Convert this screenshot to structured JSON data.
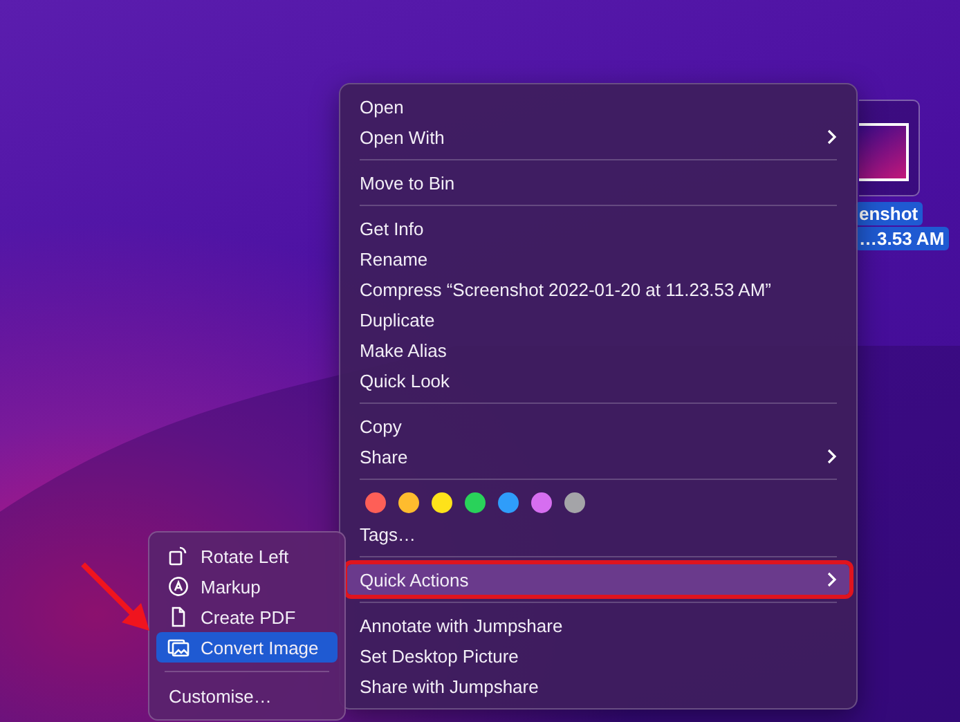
{
  "desktop_icon": {
    "label_lines": [
      "enshot",
      "…3.53 AM"
    ],
    "selected": true
  },
  "menu": {
    "sections": [
      {
        "kind": "items",
        "items": [
          {
            "label": "Open",
            "submenu": false,
            "highlighted": false,
            "outlined": false
          },
          {
            "label": "Open With",
            "submenu": true,
            "highlighted": false,
            "outlined": false
          }
        ]
      },
      {
        "kind": "items",
        "items": [
          {
            "label": "Move to Bin",
            "submenu": false,
            "highlighted": false,
            "outlined": false
          }
        ]
      },
      {
        "kind": "items",
        "items": [
          {
            "label": "Get Info",
            "submenu": false,
            "highlighted": false,
            "outlined": false
          },
          {
            "label": "Rename",
            "submenu": false,
            "highlighted": false,
            "outlined": false
          },
          {
            "label": "Compress “Screenshot 2022-01-20 at 11.23.53 AM”",
            "submenu": false,
            "highlighted": false,
            "outlined": false
          },
          {
            "label": "Duplicate",
            "submenu": false,
            "highlighted": false,
            "outlined": false
          },
          {
            "label": "Make Alias",
            "submenu": false,
            "highlighted": false,
            "outlined": false
          },
          {
            "label": "Quick Look",
            "submenu": false,
            "highlighted": false,
            "outlined": false
          }
        ]
      },
      {
        "kind": "items",
        "items": [
          {
            "label": "Copy",
            "submenu": false,
            "highlighted": false,
            "outlined": false
          },
          {
            "label": "Share",
            "submenu": true,
            "highlighted": false,
            "outlined": false
          }
        ]
      },
      {
        "kind": "tags",
        "colors": [
          {
            "color": "#fe5f57"
          },
          {
            "color": "#febc2e"
          },
          {
            "color": "#fee21a"
          },
          {
            "color": "#29d25a"
          },
          {
            "color": "#2f9dfa"
          },
          {
            "color": "#d66ef0"
          },
          {
            "color": "#a4a4a8"
          }
        ],
        "items": [
          {
            "label": "Tags…",
            "submenu": false,
            "highlighted": false,
            "outlined": false
          }
        ]
      },
      {
        "kind": "items",
        "items": [
          {
            "label": "Quick Actions",
            "submenu": true,
            "highlighted": true,
            "outlined": true
          }
        ]
      },
      {
        "kind": "items",
        "items": [
          {
            "label": "Annotate with Jumpshare",
            "submenu": false,
            "highlighted": false,
            "outlined": false
          },
          {
            "label": "Set Desktop Picture",
            "submenu": false,
            "highlighted": false,
            "outlined": false
          },
          {
            "label": "Share with Jumpshare",
            "submenu": false,
            "highlighted": false,
            "outlined": false
          }
        ]
      }
    ]
  },
  "submenu": {
    "items": [
      {
        "kind": "rotate",
        "label": "Rotate Left",
        "selected": false
      },
      {
        "kind": "markup",
        "label": "Markup",
        "selected": false
      },
      {
        "kind": "document",
        "label": "Create PDF",
        "selected": false
      },
      {
        "kind": "images",
        "label": "Convert Image",
        "selected": true
      }
    ],
    "footer": "Customise…"
  }
}
